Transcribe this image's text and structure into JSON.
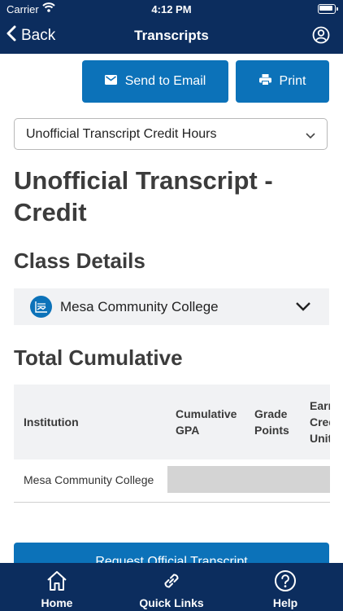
{
  "status_bar": {
    "carrier": "Carrier",
    "time": "4:12 PM"
  },
  "nav": {
    "back_label": "Back",
    "title": "Transcripts"
  },
  "actions": {
    "email_label": "Send to Email",
    "print_label": "Print"
  },
  "transcript_select": {
    "selected": "Unofficial Transcript Credit Hours"
  },
  "page_title": "Unofficial Transcript - Credit",
  "class_details": {
    "heading": "Class Details",
    "institution": "Mesa Community College"
  },
  "total_cumulative": {
    "heading": "Total Cumulative",
    "columns": [
      "Institution",
      "Cumulative GPA",
      "Grade Points",
      "Earned Credit Units"
    ],
    "rows": [
      {
        "institution": "Mesa Community College"
      }
    ]
  },
  "request_button": "Request Official Transcript",
  "tabs": [
    {
      "label": "Home",
      "icon": "home-icon"
    },
    {
      "label": "Quick Links",
      "icon": "link-icon"
    },
    {
      "label": "Help",
      "icon": "help-icon"
    }
  ],
  "colors": {
    "nav_bg": "#0c2d5e",
    "accent": "#0c72b9",
    "panel_bg": "#f1f2f4"
  }
}
